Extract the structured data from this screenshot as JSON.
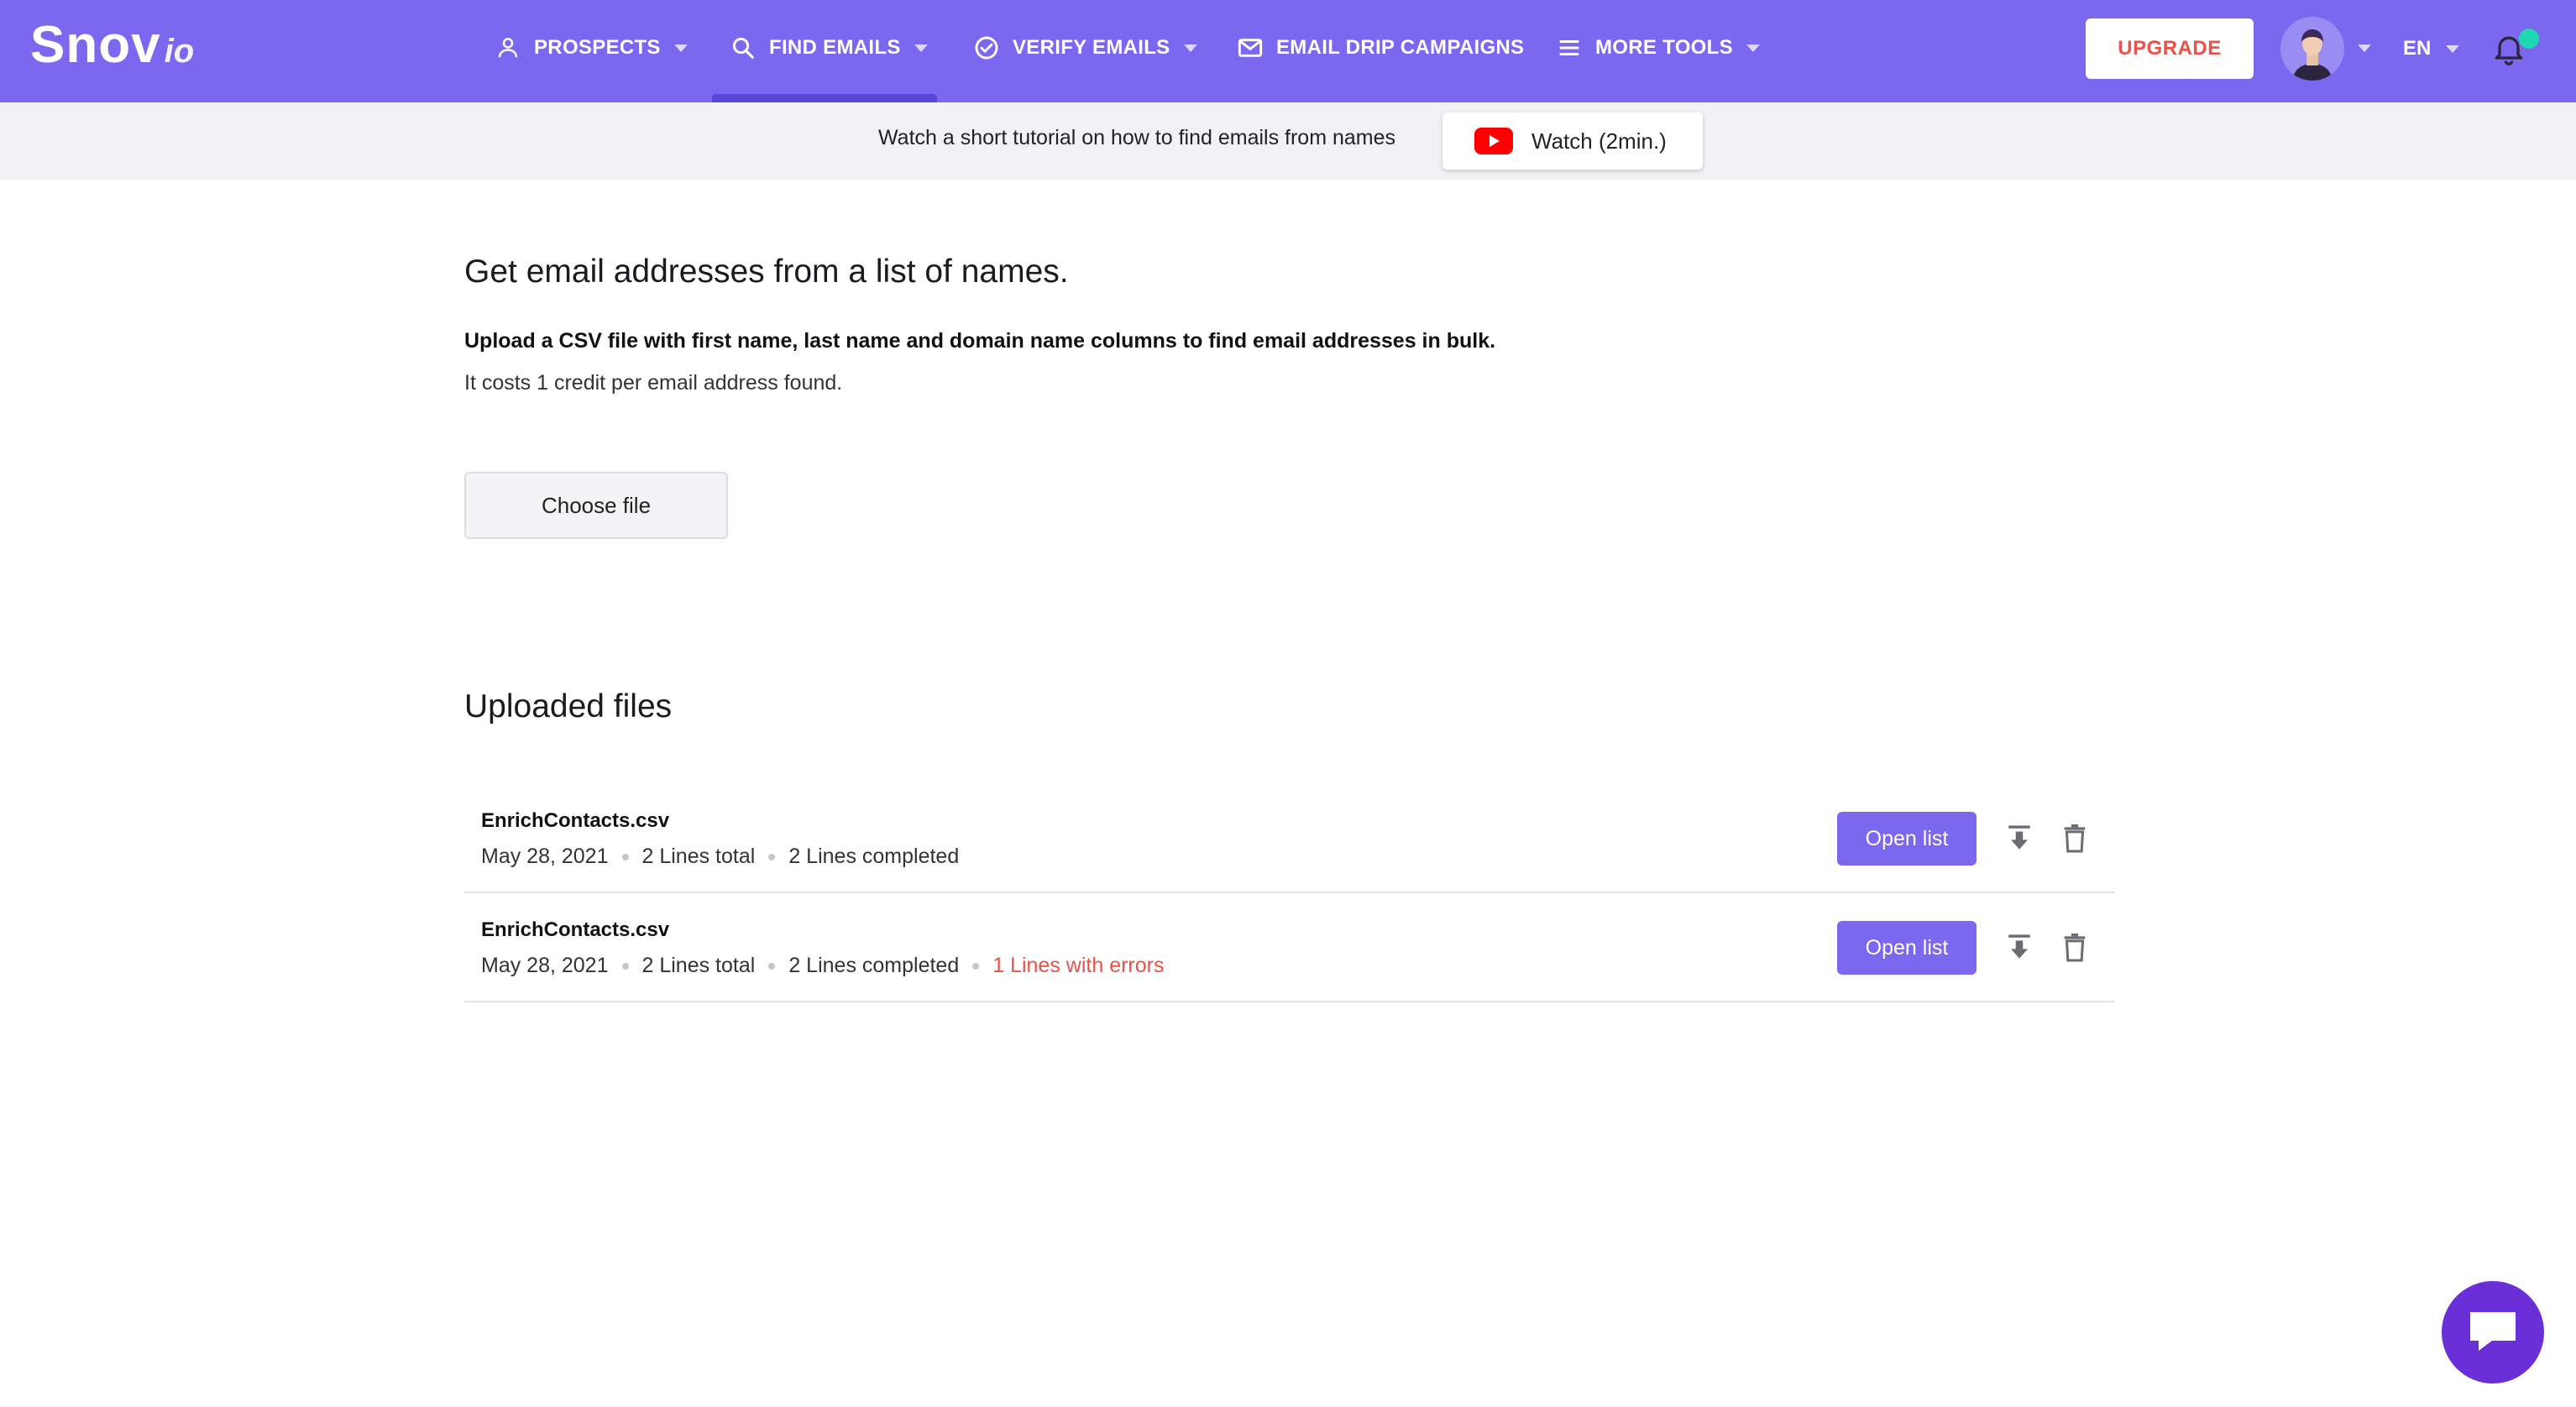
{
  "brand": {
    "name": "Snov",
    "suffix": "io"
  },
  "nav": {
    "items": [
      {
        "label": "PROSPECTS",
        "icon": "person-icon",
        "has_dropdown": true
      },
      {
        "label": "FIND EMAILS",
        "icon": "search-icon",
        "has_dropdown": true,
        "active": true
      },
      {
        "label": "VERIFY EMAILS",
        "icon": "check-circle-icon",
        "has_dropdown": true
      },
      {
        "label": "EMAIL DRIP CAMPAIGNS",
        "icon": "envelope-icon",
        "has_dropdown": false
      },
      {
        "label": "MORE TOOLS",
        "icon": "menu-icon",
        "has_dropdown": true
      }
    ],
    "upgrade_label": "UPGRADE",
    "language": "EN"
  },
  "tutorial": {
    "text": "Watch a short tutorial on how to find emails from names",
    "watch_label": "Watch (2min.)"
  },
  "main": {
    "title": "Get email addresses from a list of names.",
    "instructions": "Upload a CSV file with first name, last name and domain name columns to find email addresses in bulk.",
    "cost_note": "It costs 1 credit per email address found.",
    "choose_file_label": "Choose file"
  },
  "uploaded": {
    "title": "Uploaded files",
    "open_label": "Open list",
    "files": [
      {
        "name": "EnrichContacts.csv",
        "date": "May 28, 2021",
        "total": "2 Lines total",
        "completed": "2 Lines completed",
        "errors": ""
      },
      {
        "name": "EnrichContacts.csv",
        "date": "May 28, 2021",
        "total": "2 Lines total",
        "completed": "2 Lines completed",
        "errors": "1 Lines with errors"
      }
    ]
  },
  "colors": {
    "primary": "#7b68ee",
    "active_indicator": "#5a46d8",
    "upgrade_text": "#e8524a",
    "error_text": "#e8524a",
    "notification_dot": "#1ed8b1",
    "chat_bubble": "#6a2fd6"
  }
}
